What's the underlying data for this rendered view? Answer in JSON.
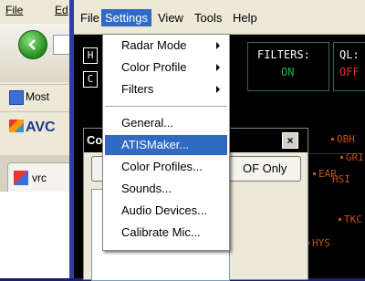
{
  "browser": {
    "menu": [
      "File",
      "Ed"
    ],
    "favorites_label": "Most",
    "avg_label": "AVC",
    "tab_label": "vrc"
  },
  "app": {
    "menu": [
      "File",
      "Settings",
      "View",
      "Tools",
      "Help"
    ],
    "active_menu": "Settings",
    "keys": [
      "H",
      "C"
    ],
    "filters_title": "FILTERS:",
    "filters_value": "ON",
    "ql_title": "QL:",
    "ql_value": "OFF",
    "targets": [
      "OBH",
      "GRI",
      "EAR",
      "HSI",
      "TKC",
      "HYS"
    ]
  },
  "dialog": {
    "title": "Co",
    "close": "×",
    "button_label": "OF Only"
  },
  "settings_menu": {
    "items": [
      {
        "label": "Radar Mode",
        "submenu": true
      },
      {
        "label": "Color Profile",
        "submenu": true
      },
      {
        "label": "Filters",
        "submenu": true
      },
      {
        "label": "General...",
        "submenu": false
      },
      {
        "label": "ATISMaker...",
        "submenu": false,
        "highlighted": true
      },
      {
        "label": "Color Profiles...",
        "submenu": false
      },
      {
        "label": "Sounds...",
        "submenu": false
      },
      {
        "label": "Audio Devices...",
        "submenu": false
      },
      {
        "label": "Calibrate Mic...",
        "submenu": false
      }
    ]
  },
  "colors": {
    "menu_highlight": "#316ac5",
    "radar_bg": "#000000",
    "target_orange": "#c3530f",
    "filters_on": "#22b14c",
    "ql_off": "#e03030"
  }
}
